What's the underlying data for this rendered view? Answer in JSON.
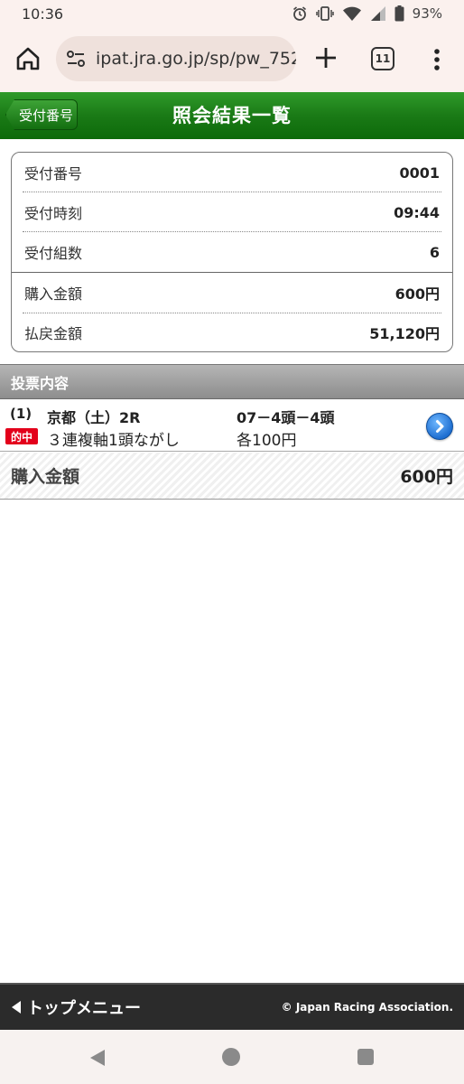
{
  "status": {
    "time": "10:36",
    "battery": "93%"
  },
  "browser": {
    "url": "ipat.jra.go.jp/sp/pw_752_",
    "tab_count": "11"
  },
  "header": {
    "back_label": "受付番号",
    "title": "照会結果一覧",
    "color": "#1a7a16"
  },
  "summary": {
    "rows": [
      {
        "label": "受付番号",
        "value": "0001"
      },
      {
        "label": "受付時刻",
        "value": "09:44"
      },
      {
        "label": "受付組数",
        "value": "6"
      },
      {
        "label": "購入金額",
        "value": "600円"
      },
      {
        "label": "払戻金額",
        "value": "51,120円"
      }
    ]
  },
  "votes": {
    "section_title": "投票内容",
    "entries": [
      {
        "number": "(1)",
        "race": "京都（土）2R",
        "combination": "07－4頭－4頭",
        "badge": "的中",
        "bet_type": "３連複軸1頭ながし",
        "amount": "各100円"
      }
    ]
  },
  "total": {
    "label": "購入金額",
    "value": "600円"
  },
  "footer": {
    "top_menu": "トップメニュー",
    "copyright": "© Japan Racing Association."
  },
  "icons": {
    "home": "home-icon",
    "tune": "tune-icon",
    "plus": "plus-icon",
    "more": "more-vert-icon",
    "detail": "chevron-right-circle-icon",
    "alarm": "alarm-icon",
    "vibrate": "vibrate-icon",
    "wifi": "wifi-icon",
    "signal": "signal-icon",
    "battery": "battery-icon"
  }
}
